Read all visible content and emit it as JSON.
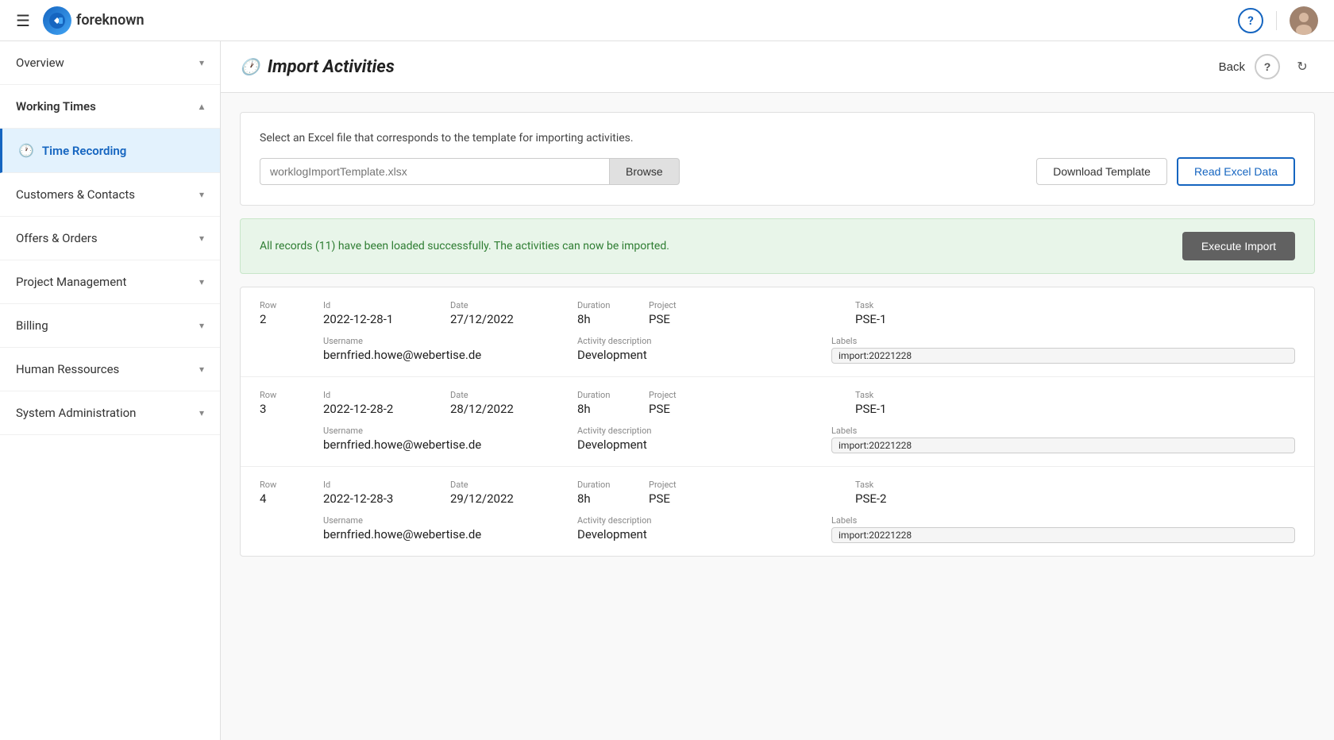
{
  "header": {
    "logo_text": "foreknown",
    "hamburger_label": "☰",
    "help_icon": "?",
    "refresh_icon": "↻",
    "back_label": "Back"
  },
  "sidebar": {
    "items": [
      {
        "id": "overview",
        "label": "Overview",
        "chevron": "▾",
        "active": false,
        "icon": ""
      },
      {
        "id": "working-times",
        "label": "Working Times",
        "chevron": "▴",
        "active": false,
        "icon": ""
      },
      {
        "id": "time-recording",
        "label": "Time Recording",
        "chevron": "",
        "active": true,
        "icon": "🕐"
      },
      {
        "id": "customers-contacts",
        "label": "Customers & Contacts",
        "chevron": "▾",
        "active": false,
        "icon": ""
      },
      {
        "id": "offers-orders",
        "label": "Offers & Orders",
        "chevron": "▾",
        "active": false,
        "icon": ""
      },
      {
        "id": "project-management",
        "label": "Project Management",
        "chevron": "▾",
        "active": false,
        "icon": ""
      },
      {
        "id": "billing",
        "label": "Billing",
        "chevron": "▾",
        "active": false,
        "icon": ""
      },
      {
        "id": "human-ressources",
        "label": "Human Ressources",
        "chevron": "▾",
        "active": false,
        "icon": ""
      },
      {
        "id": "system-administration",
        "label": "System Administration",
        "chevron": "▾",
        "active": false,
        "icon": ""
      }
    ]
  },
  "page": {
    "title": "Import Activities",
    "description": "Select an Excel file that corresponds to the template for importing activities.",
    "file_placeholder": "worklogImportTemplate.xlsx",
    "browse_label": "Browse",
    "download_template_label": "Download Template",
    "read_excel_label": "Read Excel Data",
    "success_message": "All records (11) have been loaded successfully. The activities can now be imported.",
    "execute_import_label": "Execute Import",
    "back_label": "Back"
  },
  "records": [
    {
      "row": "2",
      "id": "2022-12-28-1",
      "date": "27/12/2022",
      "duration": "8h",
      "project": "PSE",
      "task": "PSE-1",
      "username": "bernfried.howe@webertise.de",
      "activity_description": "Development",
      "labels": "import:20221228"
    },
    {
      "row": "3",
      "id": "2022-12-28-2",
      "date": "28/12/2022",
      "duration": "8h",
      "project": "PSE",
      "task": "PSE-1",
      "username": "bernfried.howe@webertise.de",
      "activity_description": "Development",
      "labels": "import:20221228"
    },
    {
      "row": "4",
      "id": "2022-12-28-3",
      "date": "29/12/2022",
      "duration": "8h",
      "project": "PSE",
      "task": "PSE-2",
      "username": "bernfried.howe@webertise.de",
      "activity_description": "Development",
      "labels": "import:20221228"
    }
  ],
  "field_labels": {
    "row": "Row",
    "id": "Id",
    "date": "Date",
    "duration": "Duration",
    "project": "Project",
    "task": "Task",
    "username": "Username",
    "activity_description": "Activity description",
    "labels": "Labels"
  }
}
